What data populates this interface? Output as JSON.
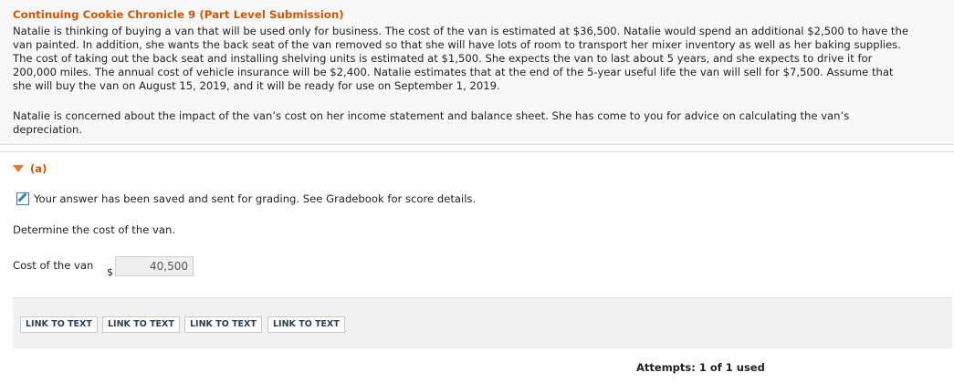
{
  "problem": {
    "title": "Continuing Cookie Chronicle 9 (Part Level Submission)",
    "body_lines": [
      "Natalie is thinking of buying a van that will be used only for business. The cost of the van is estimated at $36,500. Natalie would spend an additional $2,500 to have the",
      "van painted. In addition, she wants the back seat of the van removed so that she will have lots of room to transport her mixer inventory as well as her baking supplies.",
      "The cost of taking out the back seat and installing shelving units is estimated at $1,500. She expects the van to last about 5 years, and she expects to drive it for",
      "200,000 miles. The annual cost of vehicle insurance will be $2,400. Natalie estimates that at the end of the 5-year useful life the van will sell for $7,500. Assume that",
      "she will buy the van on August 15, 2019, and it will be ready for use on September 1, 2019."
    ],
    "concern_lines": [
      "Natalie is concerned about the impact of the van’s cost on her income statement and balance sheet. She has come to you for advice on calculating the van’s",
      "depreciation."
    ]
  },
  "part": {
    "label": "(a)",
    "saved_message": "Your answer has been saved and sent for grading. See Gradebook for score details.",
    "question": "Determine the cost of the van.",
    "answer_label": "Cost of the van",
    "currency": "$",
    "answer_value": "40,500"
  },
  "links": [
    "LINK TO TEXT",
    "LINK TO TEXT",
    "LINK TO TEXT",
    "LINK TO TEXT"
  ],
  "attempts": "Attempts: 1 of 1 used",
  "colors": {
    "accent": "#d35400",
    "link_text": "#2c3e50",
    "icon": "#2f7fb8"
  }
}
